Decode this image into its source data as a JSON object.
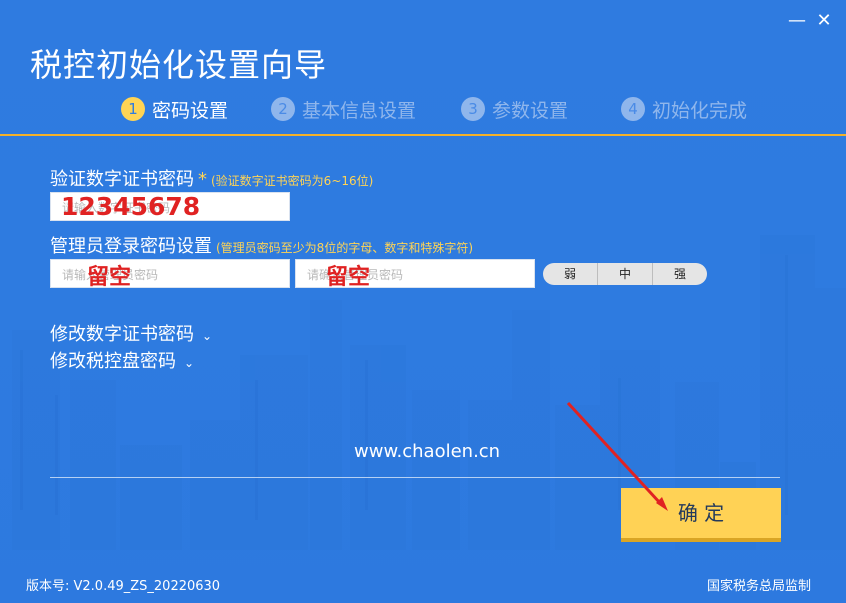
{
  "window": {
    "minimize_label": "—",
    "close_label": "✕",
    "title": "税控初始化设置向导"
  },
  "steps": [
    {
      "number": "1",
      "label": "密码设置"
    },
    {
      "number": "2",
      "label": "基本信息设置"
    },
    {
      "number": "3",
      "label": "参数设置"
    },
    {
      "number": "4",
      "label": "初始化完成"
    }
  ],
  "form": {
    "cert_password": {
      "label": "验证数字证书密码",
      "required_mark": "*",
      "hint": "(验证数字证书密码为6~16位)",
      "placeholder": "请输入数字证书密码",
      "value": "12345678"
    },
    "admin_password": {
      "label": "管理员登录密码设置",
      "hint": "(管理员密码至少为8位的字母、数字和特殊字符)",
      "first_placeholder": "请输入管理员密码",
      "first_note": "留空",
      "second_placeholder": "请确认管理员密码",
      "second_note": "留空"
    },
    "strength": [
      "弱",
      "中",
      "强"
    ]
  },
  "links": {
    "modify_cert": "修改数字证书密码",
    "modify_tax": "修改税控盘密码",
    "chevron": "⌄"
  },
  "watermark": "www.chaolen.cn",
  "confirm_label": "确 定",
  "footer": {
    "version": "版本号: V2.0.49_ZS_20220630",
    "supervisor": "国家税务总局监制"
  },
  "colors": {
    "background": "#2f7be0",
    "accent": "#ffd455",
    "button": "#ffd255",
    "annotation": "#e02222"
  }
}
